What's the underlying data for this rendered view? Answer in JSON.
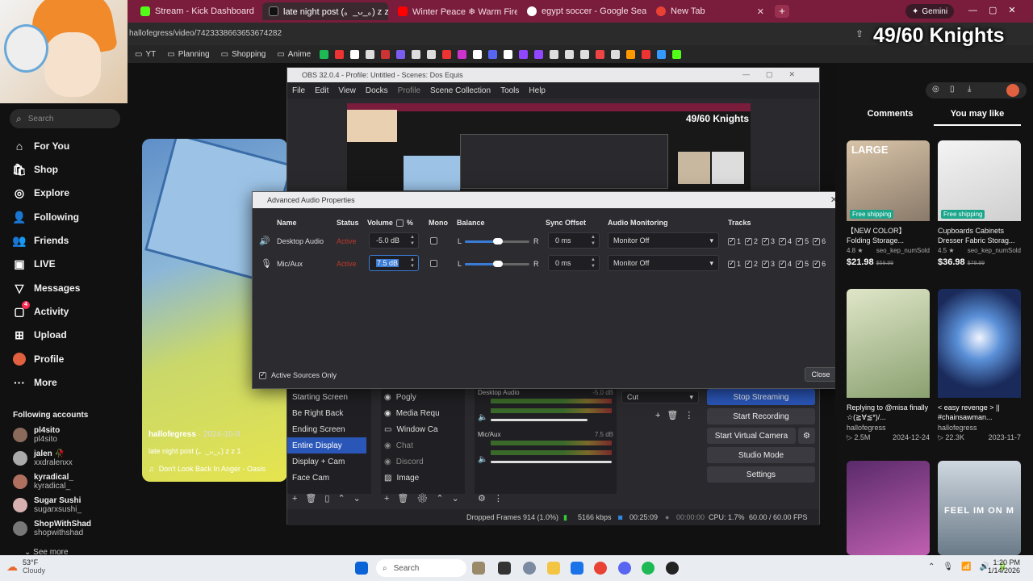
{
  "browser": {
    "tabs": [
      {
        "label": "Stream - Kick Dashboard",
        "color": "#53fc18"
      },
      {
        "label": "late night post (。_ᴗ_。) z z 1",
        "color": "#111111"
      },
      {
        "label": "Winter Peace ❄ Warm Fireplac",
        "color": "#ff0000"
      },
      {
        "label": "egypt soccer - Google Search",
        "color": "#4285f4"
      },
      {
        "label": "New Tab",
        "color": "#e94235"
      }
    ],
    "gemini_label": "Gemini",
    "url": "hallofegress/video/7423338663653674282",
    "bookmarks": [
      "YT",
      "Planning",
      "Shopping",
      "Anime"
    ]
  },
  "stream_overlay": "49/60 Knights",
  "sidebar": {
    "search_placeholder": "Search",
    "nav": [
      {
        "label": "For You",
        "icon": "home-icon"
      },
      {
        "label": "Shop",
        "icon": "shop-icon"
      },
      {
        "label": "Explore",
        "icon": "compass-icon"
      },
      {
        "label": "Following",
        "icon": "following-icon"
      },
      {
        "label": "Friends",
        "icon": "friends-icon"
      },
      {
        "label": "LIVE",
        "icon": "live-icon"
      },
      {
        "label": "Messages",
        "icon": "messages-icon"
      },
      {
        "label": "Activity",
        "icon": "activity-icon"
      },
      {
        "label": "Upload",
        "icon": "upload-icon"
      },
      {
        "label": "Profile",
        "icon": "profile-icon"
      },
      {
        "label": "More",
        "icon": "more-icon"
      }
    ],
    "activity_badge": "4",
    "following_heading": "Following accounts",
    "accounts": [
      {
        "name": "pl4sito",
        "handle": "pl4sito"
      },
      {
        "name": "jalen 🥀",
        "handle": "xxdralenxx"
      },
      {
        "name": "kyradical_",
        "handle": "kyradical_"
      },
      {
        "name": "Sugar Sushi",
        "handle": "sugarxsushi_"
      },
      {
        "name": "ShopWithShad",
        "handle": "shopwithshad"
      }
    ],
    "see_more": "See more"
  },
  "video": {
    "author": "hallofegress",
    "date": "· 2024-10-8",
    "caption": "late night post (。_ᴗ_。) z z 1",
    "music": "Don't Look Back In Anger - Oasis"
  },
  "obs": {
    "title": "OBS 32.0.4 - Profile: Untitled - Scenes: Dos Equis",
    "menu": [
      "File",
      "Edit",
      "View",
      "Docks",
      "Profile",
      "Scene Collection",
      "Tools",
      "Help"
    ],
    "scenes": [
      "Starting Screen",
      "Be Right Back",
      "Ending Screen",
      "Entire Display",
      "Display + Cam",
      "Face Cam"
    ],
    "selected_scene": "Entire Display",
    "sources": [
      "Pogly",
      "Media Requ",
      "Window Ca",
      "Chat",
      "Discord",
      "Image"
    ],
    "mixer": [
      {
        "name": "Desktop Audio",
        "db": "-5.0 dB"
      },
      {
        "name": "Mic/Aux",
        "db": "7.5 dB"
      }
    ],
    "transition": "Cut",
    "controls": [
      "Stop Streaming",
      "Start Recording",
      "Start Virtual Camera",
      "Studio Mode",
      "Settings"
    ],
    "status": {
      "dropped": "Dropped Frames 914 (1.0%)",
      "kbps": "5166 kbps",
      "live_time": "00:25:09",
      "rec_time": "00:00:00",
      "cpu": "CPU: 1.7%",
      "fps": "60.00 / 60.00 FPS"
    }
  },
  "dialog": {
    "title": "Advanced Audio Properties",
    "headers": {
      "name": "Name",
      "status": "Status",
      "volume": "Volume",
      "pct": "%",
      "mono": "Mono",
      "balance": "Balance",
      "sync": "Sync Offset",
      "monitoring": "Audio Monitoring",
      "tracks": "Tracks"
    },
    "rows": [
      {
        "name": "Desktop Audio",
        "status": "Active",
        "volume": "-5.0 dB",
        "sync": "0 ms",
        "monitoring": "Monitor Off",
        "icon": "speaker-icon"
      },
      {
        "name": "Mic/Aux",
        "status": "Active",
        "volume": "7.5 dB",
        "sync": "0 ms",
        "monitoring": "Monitor Off",
        "icon": "mic-icon"
      }
    ],
    "balance_left": "L",
    "balance_right": "R",
    "tracks": [
      "1",
      "2",
      "3",
      "4",
      "5",
      "6"
    ],
    "active_only_label": "Active Sources Only",
    "close_label": "Close"
  },
  "right": {
    "tabs": [
      "Comments",
      "You may like"
    ],
    "products": [
      {
        "title": "【NEW COLOR】 Folding Storage...",
        "rating": "4.8 ★",
        "sold": "seo_kep_numSold",
        "price": "$21.98",
        "old": "$59.99",
        "badge": "Free shipping",
        "overlay": "LARGE"
      },
      {
        "title": "Cupboards Cabinets Dresser Fabric Storag...",
        "rating": "4.5 ★",
        "sold": "seo_kep_numSold",
        "price": "$36.98",
        "old": "$79.99",
        "badge": "Free shipping",
        "overlay": ""
      }
    ],
    "videos": [
      {
        "title": "Replying to @misa finally ☆(≧∀≦*)/...",
        "author": "hallofegress",
        "views": "▷ 2.5M",
        "date": "2024-12-24"
      },
      {
        "title": "< easy revenge > || #chainsawman...",
        "author": "hallofegress",
        "views": "▷ 22.3K",
        "date": "2023-11-7"
      }
    ],
    "thumb_text": "FEEL IM ON M"
  },
  "taskbar": {
    "weather_temp": "53°F",
    "weather_desc": "Cloudy",
    "search_placeholder": "Search",
    "time": "1:20 PM",
    "date": "1/14/2026"
  }
}
